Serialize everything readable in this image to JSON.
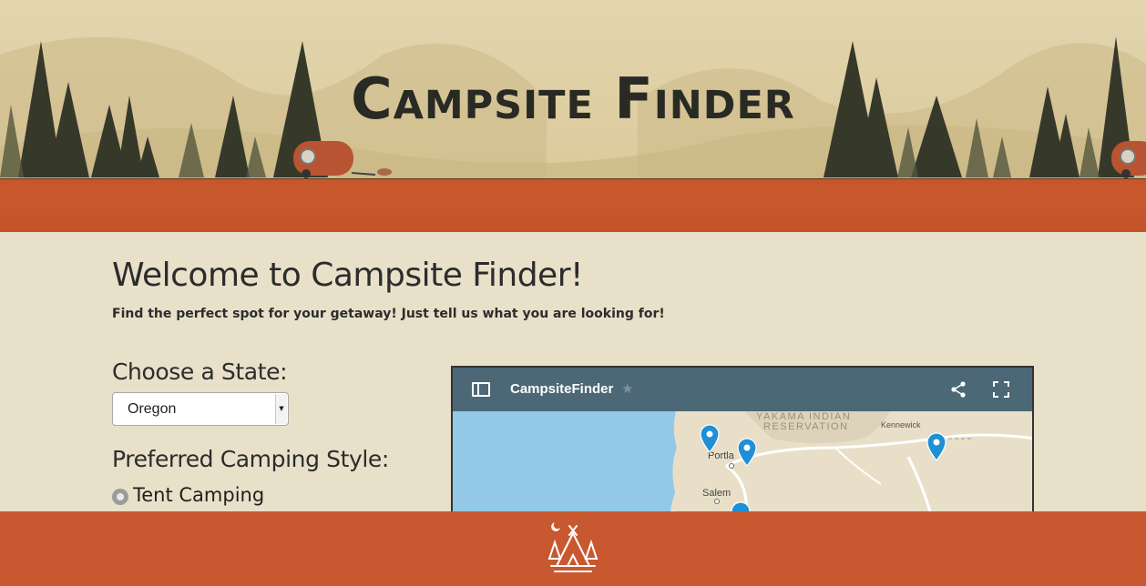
{
  "header": {
    "title": "Campsite Finder"
  },
  "main": {
    "welcome": "Welcome to Campsite Finder!",
    "subtitle": "Find the perfect spot for your getaway! Just tell us what you are looking for!",
    "state_label": "Choose a State:",
    "state_selected": "Oregon",
    "style_label": "Preferred Camping Style:",
    "style_options": [
      {
        "label": "Tent Camping",
        "checked": false
      }
    ]
  },
  "map": {
    "title": "CampsiteFinder",
    "labels": {
      "reservation_1": "YAKAMA INDIAN",
      "reservation_2": "RESERVATION",
      "kennewick": "Kennewick",
      "portland": "Portla",
      "salem": "Salem"
    }
  },
  "colors": {
    "header_ground": "#c8582d",
    "footer": "#c8582f",
    "page_bg": "#e8e0c9",
    "map_bar": "#4c6877",
    "pin": "#1f8fd6"
  },
  "icons": [
    "sidebar-icon",
    "star-icon",
    "share-icon",
    "fullscreen-icon",
    "map-pin-icon",
    "tent-logo-icon"
  ]
}
